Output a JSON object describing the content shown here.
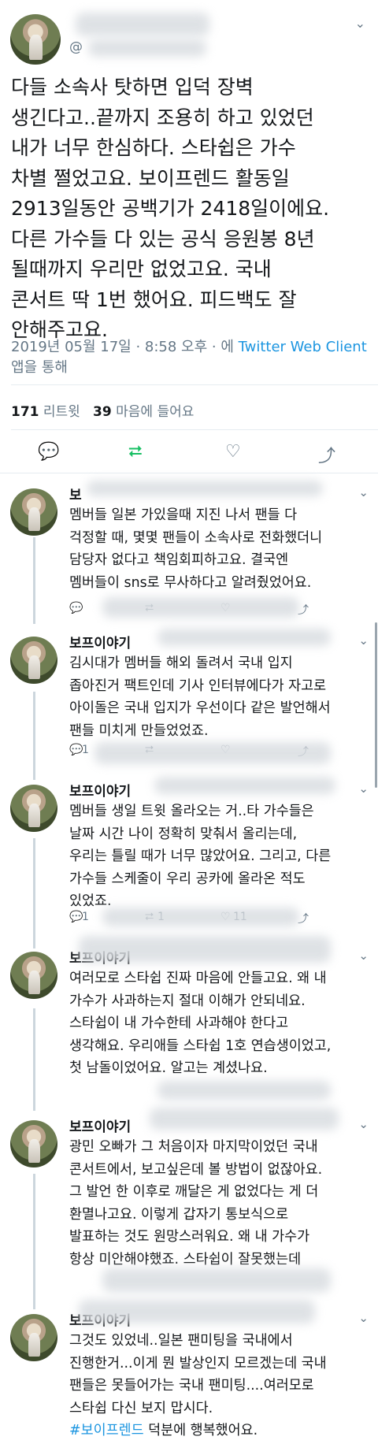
{
  "main_tweet": {
    "handle": "@",
    "text": "다들 소속사 탓하면 입덕 장벽\n생긴다고..끝까지 조용히 하고 있었던\n내가 너무 한심하다. 스타쉽은 가수\n차별 쩔었고요. 보이프렌드 활동일\n2913일동안 공백기가 2418일이에요.\n다른 가수들 다 있는 공식 응원봉 8년\n될때까지 우리만 없었고요. 국내\n콘서트 딱 1번 했어요. 피드백도 잘\n안해주고요.",
    "meta_time": "2019년 05월 17일 · 8:58 오후 · 에 ",
    "meta_source": "Twitter Web Client",
    "meta_suffix": " 앱을 통해",
    "retweets": "171",
    "retweets_label": "리트윗",
    "likes": "39",
    "likes_label": "마음에 들어요"
  },
  "icons": {
    "reply": "💬",
    "retweet": "⮂",
    "like": "♡",
    "share": "⤴",
    "caret": "⌄"
  },
  "replies": [
    {
      "name": "보",
      "text": "멤버들 일본 가있을때 지진 나서 팬들 다\n걱정할 때, 몇몇 팬들이 소속사로 전화했더니\n담당자 없다고 책임회피하고요. 결국엔\n멤버들이 sns로 무사하다고 알려줬었어요.",
      "reply_count": "",
      "retweet_count": "",
      "like_count": ""
    },
    {
      "name": "보프이야기",
      "text": "김시대가 멤버들 해외 돌려서 국내 입지\n좁아진거 팩트인데 기사 인터뷰에다가 자고로\n아이돌은 국내 입지가 우선이다 같은 발언해서\n팬들 미치게 만들었었죠.",
      "reply_count": "1",
      "retweet_count": "",
      "like_count": ""
    },
    {
      "name": "보프이야기",
      "text": "멤버들 생일 트윗 올라오는 거..타 가수들은\n날짜 시간 나이 정확히 맞춰서 올리는데,\n우리는 틀릴 때가 너무 많았어요. 그리고, 다른\n가수들 스케줄이 우리 공카에 올라온 적도\n있었죠.",
      "reply_count": "1",
      "retweet_count": "1",
      "like_count": "11"
    },
    {
      "name": "보프이야기",
      "text": "여러모로 스타쉽 진짜 마음에 안들고요. 왜 내\n가수가 사과하는지 절대 이해가 안되네요.\n스타쉽이 내 가수한테 사과해야 한다고\n생각해요. 우리애들 스타쉽 1호 연습생이었고,\n첫 남돌이었어요. 알고는 계셨나요.",
      "reply_count": "",
      "retweet_count": "",
      "like_count": ""
    },
    {
      "name": "보프이야기",
      "text": "광민 오빠가 그 처음이자 마지막이었던 국내\n콘서트에서, 보고싶은데 볼 방법이 없잖아요.\n그 발언 한 이후로 깨달은 게 없었다는 게 더\n환멸나고요. 이렇게 갑자기 통보식으로\n발표하는 것도 원망스러워요. 왜 내 가수가\n항상 미안해야했죠. 스타쉽이 잘못했는데",
      "reply_count": "",
      "retweet_count": "",
      "like_count": ""
    },
    {
      "name": "보프이야기",
      "text_before": "그것도 있었네..일본 팬미팅을 국내에서\n진행한거...이게 뭔 발상인지 모르겠는데 국내\n팬들은 못들어가는 국내 팬미팅....여러모로\n스타쉽 다신 보지 맙시다.\n",
      "hashtag": "#보이프렌드",
      "text_after": " 덕분에 행복했어요."
    }
  ]
}
